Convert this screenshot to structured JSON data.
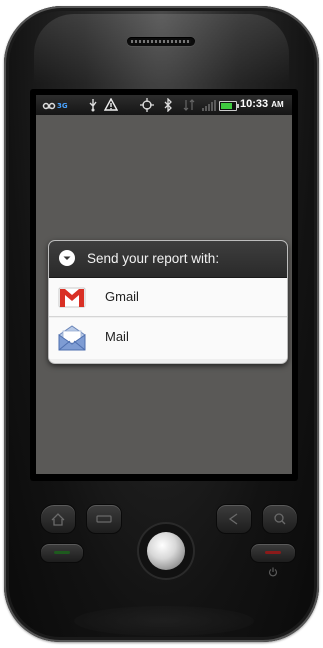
{
  "status_bar": {
    "time": "10:33",
    "ampm": "AM",
    "icons": [
      "voicemail-icon",
      "network-icon",
      "usb-icon",
      "warning-icon",
      "gps-icon",
      "bluetooth-icon",
      "data-icon",
      "signal-icon",
      "battery-icon"
    ],
    "battery_level": 0.8
  },
  "dialog": {
    "title": "Send your report with:",
    "options": [
      {
        "label": "Gmail",
        "icon": "gmail-icon"
      },
      {
        "label": "Mail",
        "icon": "mail-icon"
      }
    ]
  },
  "colors": {
    "screen_bg": "#5a5957",
    "dialog_header": "#333333",
    "gmail_red": "#d93025",
    "battery_green": "#3fc83f"
  }
}
